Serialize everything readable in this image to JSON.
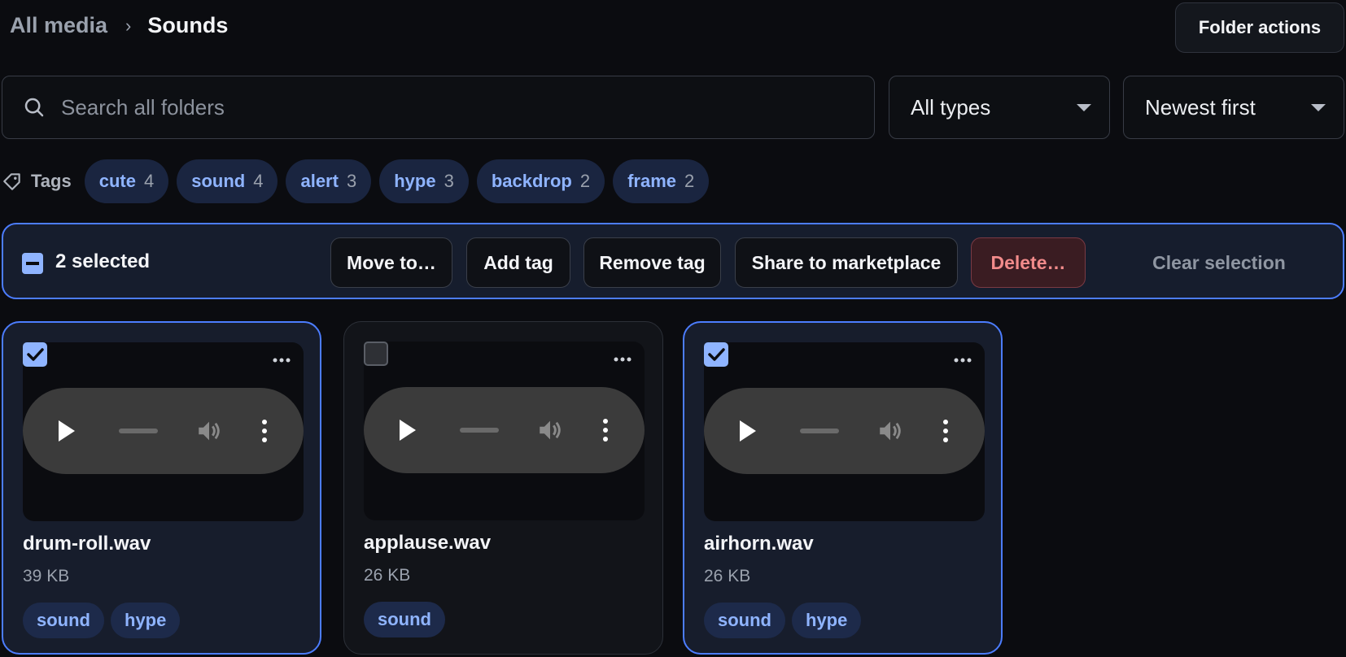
{
  "breadcrumb": {
    "root": "All media",
    "separator": "›",
    "current": "Sounds"
  },
  "header": {
    "folder_actions_label": "Folder actions"
  },
  "search": {
    "placeholder": "Search all folders"
  },
  "filters": {
    "type_selected": "All types",
    "sort_selected": "Newest first"
  },
  "tags": {
    "label": "Tags",
    "items": [
      {
        "name": "cute",
        "count": "4"
      },
      {
        "name": "sound",
        "count": "4"
      },
      {
        "name": "alert",
        "count": "3"
      },
      {
        "name": "hype",
        "count": "3"
      },
      {
        "name": "backdrop",
        "count": "2"
      },
      {
        "name": "frame",
        "count": "2"
      }
    ]
  },
  "selection": {
    "count_label": "2 selected",
    "actions": {
      "move": "Move to…",
      "add_tag": "Add tag",
      "remove_tag": "Remove tag",
      "share": "Share to marketplace",
      "delete": "Delete…",
      "clear": "Clear selection"
    }
  },
  "files": [
    {
      "name": "drum-roll.wav",
      "size": "39 KB",
      "selected": true,
      "tags": [
        "sound",
        "hype"
      ]
    },
    {
      "name": "applause.wav",
      "size": "26 KB",
      "selected": false,
      "tags": [
        "sound"
      ]
    },
    {
      "name": "airhorn.wav",
      "size": "26 KB",
      "selected": true,
      "tags": [
        "sound",
        "hype"
      ]
    }
  ],
  "colors": {
    "accent": "#4c7dff",
    "tag_text": "#8fb4ff",
    "danger": "#f28b8b",
    "background": "#0b0c10"
  },
  "icons": {
    "search": "search-icon",
    "tag": "tag-icon",
    "more": "more-horizontal-icon",
    "play": "play-icon",
    "volume": "volume-icon",
    "kebab": "more-vertical-icon",
    "check": "check-icon"
  }
}
